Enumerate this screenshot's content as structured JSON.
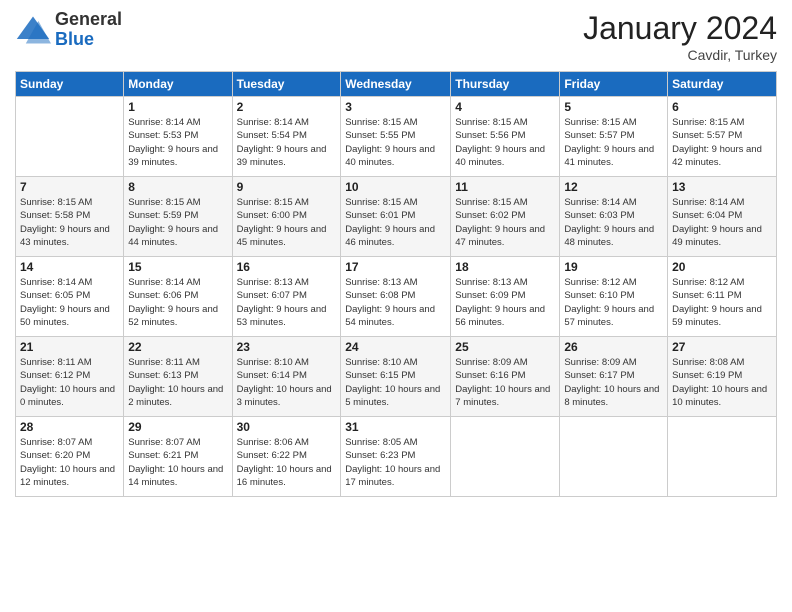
{
  "header": {
    "logo_general": "General",
    "logo_blue": "Blue",
    "month_title": "January 2024",
    "location": "Cavdir, Turkey"
  },
  "calendar": {
    "days_of_week": [
      "Sunday",
      "Monday",
      "Tuesday",
      "Wednesday",
      "Thursday",
      "Friday",
      "Saturday"
    ],
    "weeks": [
      [
        {
          "day": "",
          "sunrise": "",
          "sunset": "",
          "daylight": ""
        },
        {
          "day": "1",
          "sunrise": "Sunrise: 8:14 AM",
          "sunset": "Sunset: 5:53 PM",
          "daylight": "Daylight: 9 hours and 39 minutes."
        },
        {
          "day": "2",
          "sunrise": "Sunrise: 8:14 AM",
          "sunset": "Sunset: 5:54 PM",
          "daylight": "Daylight: 9 hours and 39 minutes."
        },
        {
          "day": "3",
          "sunrise": "Sunrise: 8:15 AM",
          "sunset": "Sunset: 5:55 PM",
          "daylight": "Daylight: 9 hours and 40 minutes."
        },
        {
          "day": "4",
          "sunrise": "Sunrise: 8:15 AM",
          "sunset": "Sunset: 5:56 PM",
          "daylight": "Daylight: 9 hours and 40 minutes."
        },
        {
          "day": "5",
          "sunrise": "Sunrise: 8:15 AM",
          "sunset": "Sunset: 5:57 PM",
          "daylight": "Daylight: 9 hours and 41 minutes."
        },
        {
          "day": "6",
          "sunrise": "Sunrise: 8:15 AM",
          "sunset": "Sunset: 5:57 PM",
          "daylight": "Daylight: 9 hours and 42 minutes."
        }
      ],
      [
        {
          "day": "7",
          "sunrise": "Sunrise: 8:15 AM",
          "sunset": "Sunset: 5:58 PM",
          "daylight": "Daylight: 9 hours and 43 minutes."
        },
        {
          "day": "8",
          "sunrise": "Sunrise: 8:15 AM",
          "sunset": "Sunset: 5:59 PM",
          "daylight": "Daylight: 9 hours and 44 minutes."
        },
        {
          "day": "9",
          "sunrise": "Sunrise: 8:15 AM",
          "sunset": "Sunset: 6:00 PM",
          "daylight": "Daylight: 9 hours and 45 minutes."
        },
        {
          "day": "10",
          "sunrise": "Sunrise: 8:15 AM",
          "sunset": "Sunset: 6:01 PM",
          "daylight": "Daylight: 9 hours and 46 minutes."
        },
        {
          "day": "11",
          "sunrise": "Sunrise: 8:15 AM",
          "sunset": "Sunset: 6:02 PM",
          "daylight": "Daylight: 9 hours and 47 minutes."
        },
        {
          "day": "12",
          "sunrise": "Sunrise: 8:14 AM",
          "sunset": "Sunset: 6:03 PM",
          "daylight": "Daylight: 9 hours and 48 minutes."
        },
        {
          "day": "13",
          "sunrise": "Sunrise: 8:14 AM",
          "sunset": "Sunset: 6:04 PM",
          "daylight": "Daylight: 9 hours and 49 minutes."
        }
      ],
      [
        {
          "day": "14",
          "sunrise": "Sunrise: 8:14 AM",
          "sunset": "Sunset: 6:05 PM",
          "daylight": "Daylight: 9 hours and 50 minutes."
        },
        {
          "day": "15",
          "sunrise": "Sunrise: 8:14 AM",
          "sunset": "Sunset: 6:06 PM",
          "daylight": "Daylight: 9 hours and 52 minutes."
        },
        {
          "day": "16",
          "sunrise": "Sunrise: 8:13 AM",
          "sunset": "Sunset: 6:07 PM",
          "daylight": "Daylight: 9 hours and 53 minutes."
        },
        {
          "day": "17",
          "sunrise": "Sunrise: 8:13 AM",
          "sunset": "Sunset: 6:08 PM",
          "daylight": "Daylight: 9 hours and 54 minutes."
        },
        {
          "day": "18",
          "sunrise": "Sunrise: 8:13 AM",
          "sunset": "Sunset: 6:09 PM",
          "daylight": "Daylight: 9 hours and 56 minutes."
        },
        {
          "day": "19",
          "sunrise": "Sunrise: 8:12 AM",
          "sunset": "Sunset: 6:10 PM",
          "daylight": "Daylight: 9 hours and 57 minutes."
        },
        {
          "day": "20",
          "sunrise": "Sunrise: 8:12 AM",
          "sunset": "Sunset: 6:11 PM",
          "daylight": "Daylight: 9 hours and 59 minutes."
        }
      ],
      [
        {
          "day": "21",
          "sunrise": "Sunrise: 8:11 AM",
          "sunset": "Sunset: 6:12 PM",
          "daylight": "Daylight: 10 hours and 0 minutes."
        },
        {
          "day": "22",
          "sunrise": "Sunrise: 8:11 AM",
          "sunset": "Sunset: 6:13 PM",
          "daylight": "Daylight: 10 hours and 2 minutes."
        },
        {
          "day": "23",
          "sunrise": "Sunrise: 8:10 AM",
          "sunset": "Sunset: 6:14 PM",
          "daylight": "Daylight: 10 hours and 3 minutes."
        },
        {
          "day": "24",
          "sunrise": "Sunrise: 8:10 AM",
          "sunset": "Sunset: 6:15 PM",
          "daylight": "Daylight: 10 hours and 5 minutes."
        },
        {
          "day": "25",
          "sunrise": "Sunrise: 8:09 AM",
          "sunset": "Sunset: 6:16 PM",
          "daylight": "Daylight: 10 hours and 7 minutes."
        },
        {
          "day": "26",
          "sunrise": "Sunrise: 8:09 AM",
          "sunset": "Sunset: 6:17 PM",
          "daylight": "Daylight: 10 hours and 8 minutes."
        },
        {
          "day": "27",
          "sunrise": "Sunrise: 8:08 AM",
          "sunset": "Sunset: 6:19 PM",
          "daylight": "Daylight: 10 hours and 10 minutes."
        }
      ],
      [
        {
          "day": "28",
          "sunrise": "Sunrise: 8:07 AM",
          "sunset": "Sunset: 6:20 PM",
          "daylight": "Daylight: 10 hours and 12 minutes."
        },
        {
          "day": "29",
          "sunrise": "Sunrise: 8:07 AM",
          "sunset": "Sunset: 6:21 PM",
          "daylight": "Daylight: 10 hours and 14 minutes."
        },
        {
          "day": "30",
          "sunrise": "Sunrise: 8:06 AM",
          "sunset": "Sunset: 6:22 PM",
          "daylight": "Daylight: 10 hours and 16 minutes."
        },
        {
          "day": "31",
          "sunrise": "Sunrise: 8:05 AM",
          "sunset": "Sunset: 6:23 PM",
          "daylight": "Daylight: 10 hours and 17 minutes."
        },
        {
          "day": "",
          "sunrise": "",
          "sunset": "",
          "daylight": ""
        },
        {
          "day": "",
          "sunrise": "",
          "sunset": "",
          "daylight": ""
        },
        {
          "day": "",
          "sunrise": "",
          "sunset": "",
          "daylight": ""
        }
      ]
    ]
  }
}
